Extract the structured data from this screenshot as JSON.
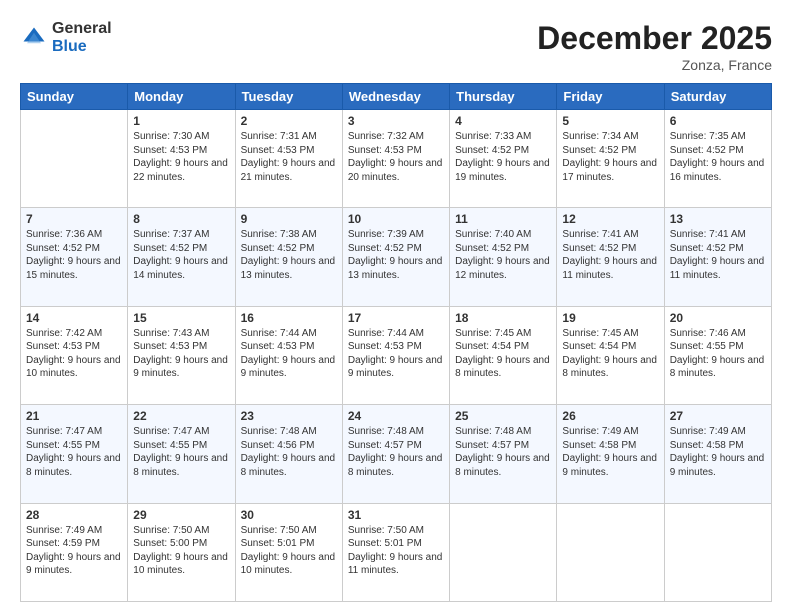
{
  "header": {
    "logo_general": "General",
    "logo_blue": "Blue",
    "month_title": "December 2025",
    "location": "Zonza, France"
  },
  "days_of_week": [
    "Sunday",
    "Monday",
    "Tuesday",
    "Wednesday",
    "Thursday",
    "Friday",
    "Saturday"
  ],
  "weeks": [
    [
      {
        "day": "",
        "sunrise": "",
        "sunset": "",
        "daylight": ""
      },
      {
        "day": "1",
        "sunrise": "Sunrise: 7:30 AM",
        "sunset": "Sunset: 4:53 PM",
        "daylight": "Daylight: 9 hours and 22 minutes."
      },
      {
        "day": "2",
        "sunrise": "Sunrise: 7:31 AM",
        "sunset": "Sunset: 4:53 PM",
        "daylight": "Daylight: 9 hours and 21 minutes."
      },
      {
        "day": "3",
        "sunrise": "Sunrise: 7:32 AM",
        "sunset": "Sunset: 4:53 PM",
        "daylight": "Daylight: 9 hours and 20 minutes."
      },
      {
        "day": "4",
        "sunrise": "Sunrise: 7:33 AM",
        "sunset": "Sunset: 4:52 PM",
        "daylight": "Daylight: 9 hours and 19 minutes."
      },
      {
        "day": "5",
        "sunrise": "Sunrise: 7:34 AM",
        "sunset": "Sunset: 4:52 PM",
        "daylight": "Daylight: 9 hours and 17 minutes."
      },
      {
        "day": "6",
        "sunrise": "Sunrise: 7:35 AM",
        "sunset": "Sunset: 4:52 PM",
        "daylight": "Daylight: 9 hours and 16 minutes."
      }
    ],
    [
      {
        "day": "7",
        "sunrise": "Sunrise: 7:36 AM",
        "sunset": "Sunset: 4:52 PM",
        "daylight": "Daylight: 9 hours and 15 minutes."
      },
      {
        "day": "8",
        "sunrise": "Sunrise: 7:37 AM",
        "sunset": "Sunset: 4:52 PM",
        "daylight": "Daylight: 9 hours and 14 minutes."
      },
      {
        "day": "9",
        "sunrise": "Sunrise: 7:38 AM",
        "sunset": "Sunset: 4:52 PM",
        "daylight": "Daylight: 9 hours and 13 minutes."
      },
      {
        "day": "10",
        "sunrise": "Sunrise: 7:39 AM",
        "sunset": "Sunset: 4:52 PM",
        "daylight": "Daylight: 9 hours and 13 minutes."
      },
      {
        "day": "11",
        "sunrise": "Sunrise: 7:40 AM",
        "sunset": "Sunset: 4:52 PM",
        "daylight": "Daylight: 9 hours and 12 minutes."
      },
      {
        "day": "12",
        "sunrise": "Sunrise: 7:41 AM",
        "sunset": "Sunset: 4:52 PM",
        "daylight": "Daylight: 9 hours and 11 minutes."
      },
      {
        "day": "13",
        "sunrise": "Sunrise: 7:41 AM",
        "sunset": "Sunset: 4:52 PM",
        "daylight": "Daylight: 9 hours and 11 minutes."
      }
    ],
    [
      {
        "day": "14",
        "sunrise": "Sunrise: 7:42 AM",
        "sunset": "Sunset: 4:53 PM",
        "daylight": "Daylight: 9 hours and 10 minutes."
      },
      {
        "day": "15",
        "sunrise": "Sunrise: 7:43 AM",
        "sunset": "Sunset: 4:53 PM",
        "daylight": "Daylight: 9 hours and 9 minutes."
      },
      {
        "day": "16",
        "sunrise": "Sunrise: 7:44 AM",
        "sunset": "Sunset: 4:53 PM",
        "daylight": "Daylight: 9 hours and 9 minutes."
      },
      {
        "day": "17",
        "sunrise": "Sunrise: 7:44 AM",
        "sunset": "Sunset: 4:53 PM",
        "daylight": "Daylight: 9 hours and 9 minutes."
      },
      {
        "day": "18",
        "sunrise": "Sunrise: 7:45 AM",
        "sunset": "Sunset: 4:54 PM",
        "daylight": "Daylight: 9 hours and 8 minutes."
      },
      {
        "day": "19",
        "sunrise": "Sunrise: 7:45 AM",
        "sunset": "Sunset: 4:54 PM",
        "daylight": "Daylight: 9 hours and 8 minutes."
      },
      {
        "day": "20",
        "sunrise": "Sunrise: 7:46 AM",
        "sunset": "Sunset: 4:55 PM",
        "daylight": "Daylight: 9 hours and 8 minutes."
      }
    ],
    [
      {
        "day": "21",
        "sunrise": "Sunrise: 7:47 AM",
        "sunset": "Sunset: 4:55 PM",
        "daylight": "Daylight: 9 hours and 8 minutes."
      },
      {
        "day": "22",
        "sunrise": "Sunrise: 7:47 AM",
        "sunset": "Sunset: 4:55 PM",
        "daylight": "Daylight: 9 hours and 8 minutes."
      },
      {
        "day": "23",
        "sunrise": "Sunrise: 7:48 AM",
        "sunset": "Sunset: 4:56 PM",
        "daylight": "Daylight: 9 hours and 8 minutes."
      },
      {
        "day": "24",
        "sunrise": "Sunrise: 7:48 AM",
        "sunset": "Sunset: 4:57 PM",
        "daylight": "Daylight: 9 hours and 8 minutes."
      },
      {
        "day": "25",
        "sunrise": "Sunrise: 7:48 AM",
        "sunset": "Sunset: 4:57 PM",
        "daylight": "Daylight: 9 hours and 8 minutes."
      },
      {
        "day": "26",
        "sunrise": "Sunrise: 7:49 AM",
        "sunset": "Sunset: 4:58 PM",
        "daylight": "Daylight: 9 hours and 9 minutes."
      },
      {
        "day": "27",
        "sunrise": "Sunrise: 7:49 AM",
        "sunset": "Sunset: 4:58 PM",
        "daylight": "Daylight: 9 hours and 9 minutes."
      }
    ],
    [
      {
        "day": "28",
        "sunrise": "Sunrise: 7:49 AM",
        "sunset": "Sunset: 4:59 PM",
        "daylight": "Daylight: 9 hours and 9 minutes."
      },
      {
        "day": "29",
        "sunrise": "Sunrise: 7:50 AM",
        "sunset": "Sunset: 5:00 PM",
        "daylight": "Daylight: 9 hours and 10 minutes."
      },
      {
        "day": "30",
        "sunrise": "Sunrise: 7:50 AM",
        "sunset": "Sunset: 5:01 PM",
        "daylight": "Daylight: 9 hours and 10 minutes."
      },
      {
        "day": "31",
        "sunrise": "Sunrise: 7:50 AM",
        "sunset": "Sunset: 5:01 PM",
        "daylight": "Daylight: 9 hours and 11 minutes."
      },
      {
        "day": "",
        "sunrise": "",
        "sunset": "",
        "daylight": ""
      },
      {
        "day": "",
        "sunrise": "",
        "sunset": "",
        "daylight": ""
      },
      {
        "day": "",
        "sunrise": "",
        "sunset": "",
        "daylight": ""
      }
    ]
  ]
}
